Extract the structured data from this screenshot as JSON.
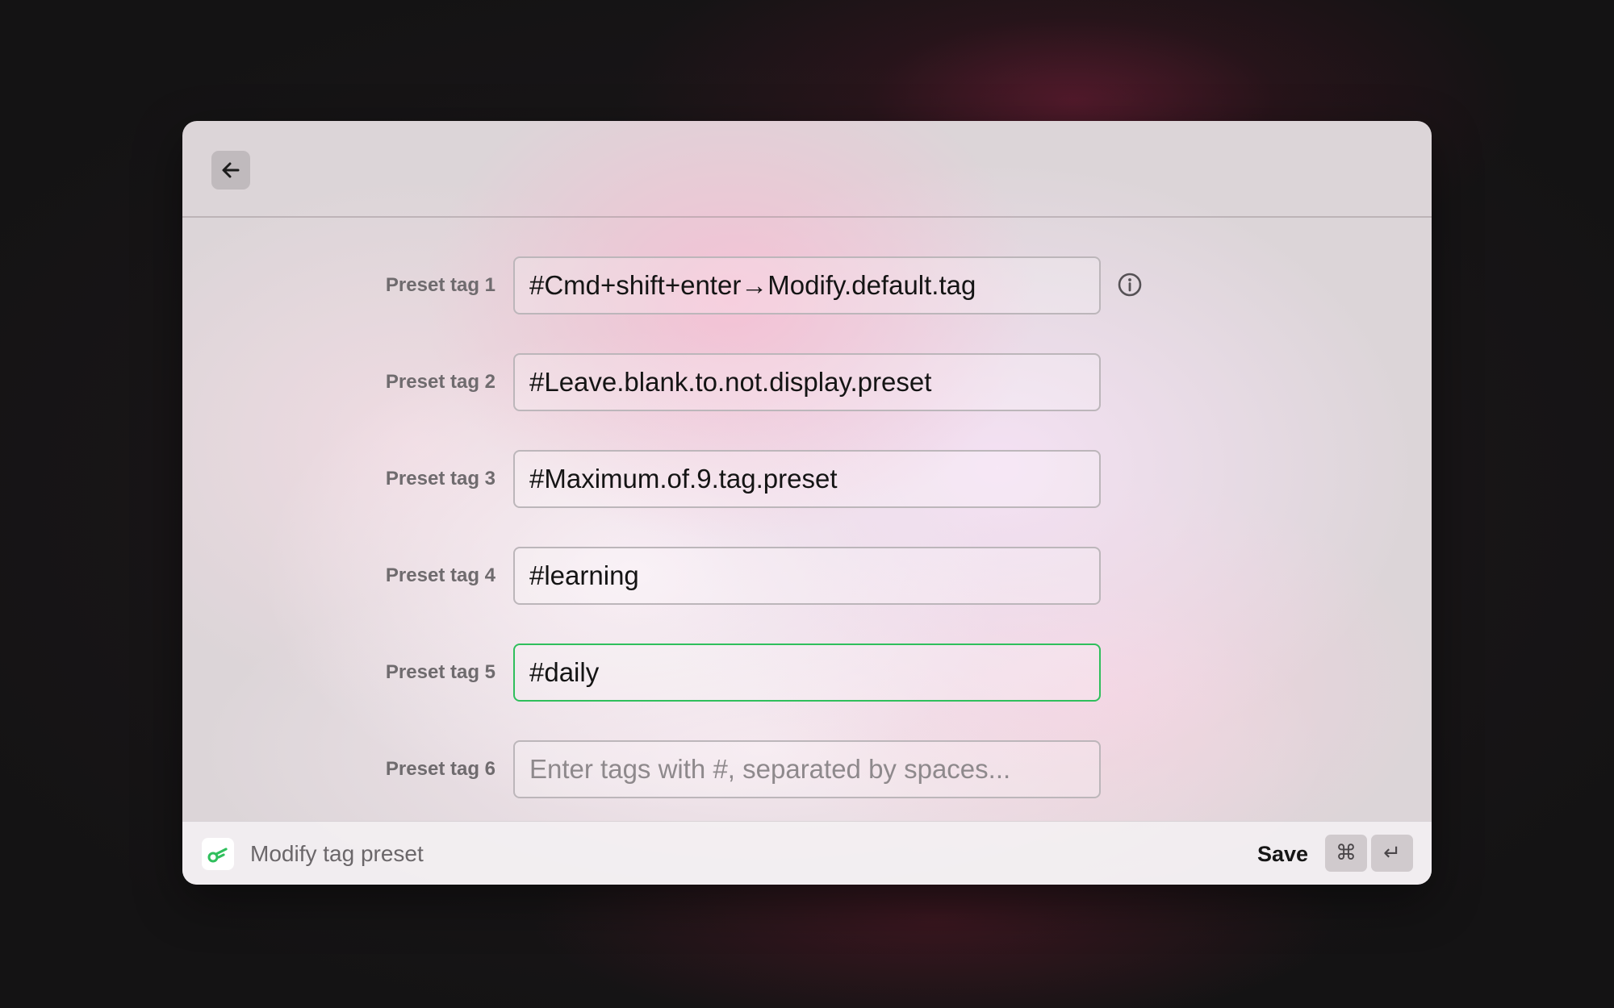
{
  "header": {
    "back_icon": "arrow-left-icon"
  },
  "form": {
    "info_icon": "info-circle-icon",
    "tags": [
      {
        "label": "Preset tag 1",
        "value": "#Cmd+shift+enter→Modify.default.tag",
        "placeholder": ""
      },
      {
        "label": "Preset tag 2",
        "value": "#Leave.blank.to.not.display.preset",
        "placeholder": ""
      },
      {
        "label": "Preset tag 3",
        "value": "#Maximum.of.9.tag.preset",
        "placeholder": ""
      },
      {
        "label": "Preset tag 4",
        "value": "#learning",
        "placeholder": ""
      },
      {
        "label": "Preset tag 5",
        "value": "#daily",
        "placeholder": ""
      },
      {
        "label": "Preset tag 6",
        "value": "",
        "placeholder": "Enter tags with #, separated by spaces..."
      }
    ]
  },
  "footer": {
    "app_icon": "key-icon",
    "title": "Modify tag preset",
    "save_label": "Save",
    "shortcut_cmd": "⌘",
    "shortcut_enter": "↵"
  },
  "colors": {
    "focus_border": "#2fbf5c",
    "app_icon_accent": "#2fbf5c"
  }
}
